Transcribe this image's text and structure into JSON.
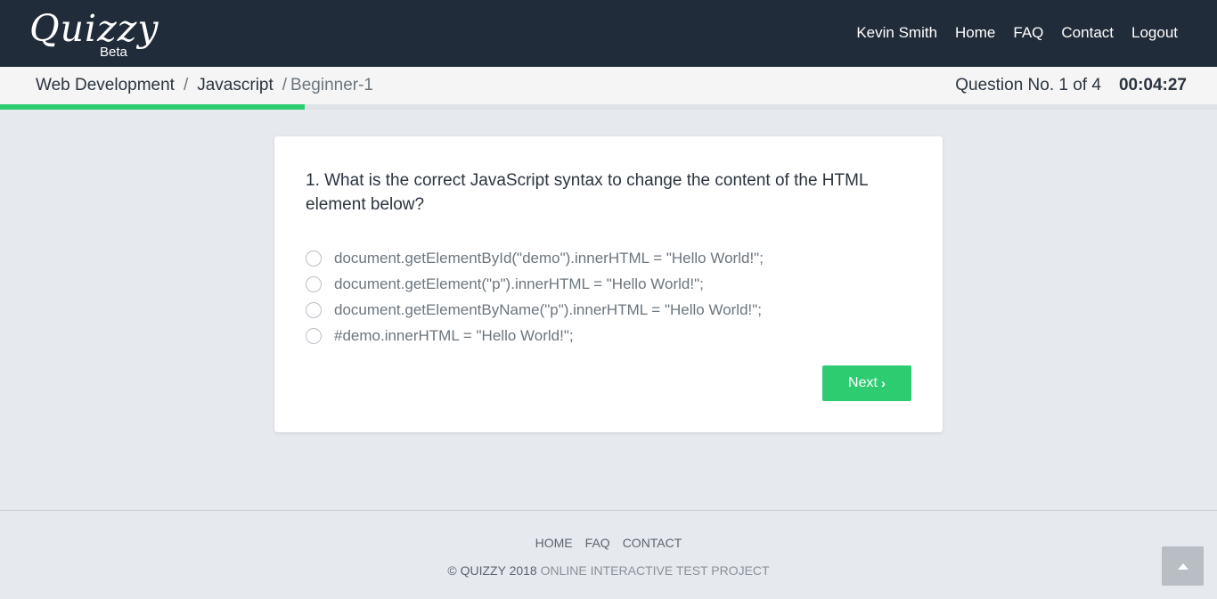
{
  "header": {
    "logo": "Quizzy",
    "logo_sub": "Beta",
    "nav": [
      "Kevin Smith",
      "Home",
      "FAQ",
      "Contact",
      "Logout"
    ]
  },
  "breadcrumb": {
    "items": [
      "Web Development",
      "Javascript",
      "Beginner-1"
    ]
  },
  "quiz": {
    "question_counter": "Question No. 1 of 4",
    "timer": "00:04:27",
    "progress": 0.25,
    "question": "1. What is the correct JavaScript syntax to change the content of the HTML element below?",
    "options": [
      "document.getElementById(\"demo\").innerHTML = \"Hello World!\";",
      "document.getElement(\"p\").innerHTML = \"Hello World!\";",
      "document.getElementByName(\"p\").innerHTML = \"Hello World!\";",
      "#demo.innerHTML = \"Hello World!\";"
    ],
    "next_label": "Next"
  },
  "footer": {
    "links": [
      "HOME",
      "FAQ",
      "CONTACT"
    ],
    "copyright": "© QUIZZY 2018",
    "project": "ONLINE INTERACTIVE TEST PROJECT"
  },
  "icons": {
    "next": "chevron-right-icon",
    "scroll_top": "triangle-up-icon"
  },
  "colors": {
    "navbar": "#212c3a",
    "accent": "#2ecc71",
    "background": "#e6e9ed"
  }
}
